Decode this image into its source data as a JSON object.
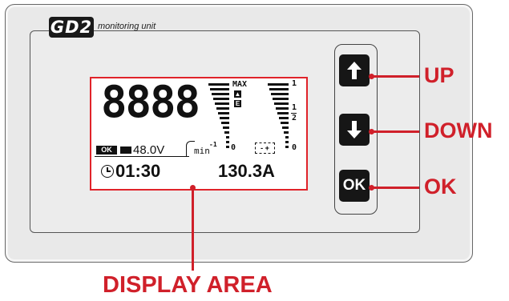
{
  "device": {
    "logo": "GD2",
    "subtitle": "monitoring unit"
  },
  "display": {
    "segments": "8888",
    "max_label": "MAX",
    "e_indicator": "E",
    "rpm_unit": "min",
    "rpm_exp": "-1",
    "zero_left": "0",
    "zero_right": "0",
    "scale_top": "1",
    "scale_half_num": "1",
    "scale_half_den": "2",
    "battery_symbol": "- +",
    "status_badge": "OK",
    "voltage": "48.0V",
    "timer": "01:30",
    "current": "130.3A"
  },
  "buttons": {
    "up_label": "UP",
    "down_label": "DOWN",
    "ok_label": "OK",
    "ok_key_text": "OK"
  },
  "callouts": {
    "display_area": "DISPLAY AREA"
  },
  "colors": {
    "accent": "#d0202a",
    "housing": "#e9e9e9",
    "key": "#161616"
  }
}
